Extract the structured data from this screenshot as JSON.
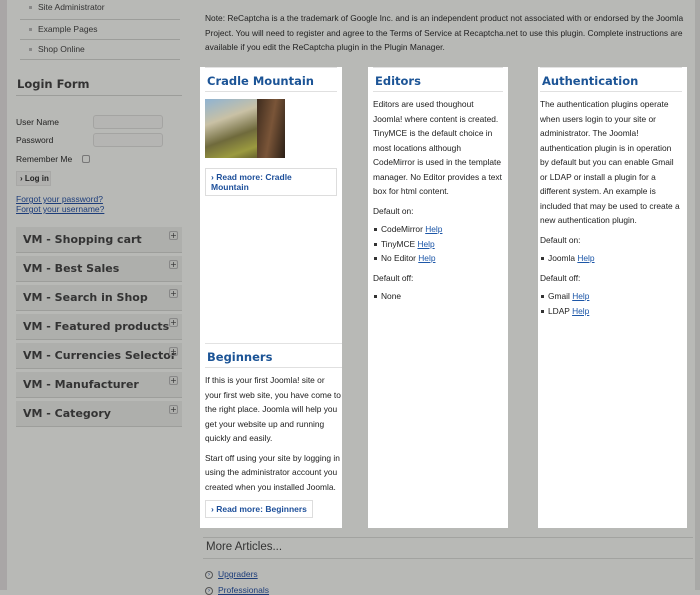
{
  "menu": [
    "Site Administrator",
    "Example Pages",
    "Shop Online"
  ],
  "login": {
    "title": "Login Form",
    "username_label": "User Name",
    "password_label": "Password",
    "remember_label": "Remember Me",
    "login_button": "Log in",
    "forgot_password": "Forgot your password?",
    "forgot_username": "Forgot your username?"
  },
  "modules": [
    "VM - Shopping cart",
    "VM - Best Sales",
    "VM - Search in Shop",
    "VM - Featured products",
    "VM - Currencies Selector",
    "VM - Manufacturer",
    "VM - Category"
  ],
  "note": "Note: ReCaptcha is a the trademark of Google Inc. and is an independent product not associated with or endorsed by the Joomla Project. You will need to register and agree to the Terms of Service at Recaptcha.net to use this plugin. Complete instructions are available if you edit the ReCaptcha plugin in the Plugin Manager.",
  "cradle": {
    "title": "Cradle Mountain",
    "read_more": "Read more: Cradle Mountain"
  },
  "beginners": {
    "title": "Beginners",
    "p1": "If this is your first Joomla! site or your first web site, you have come to the right place. Joomla will help you get your website up and running quickly and easily.",
    "p2": "Start off using your site by logging in using the administrator account you created when you installed Joomla.",
    "read_more": "Read more: Beginners"
  },
  "editors": {
    "title": "Editors",
    "p1": "Editors are used thoughout Joomla! where content is created. TinyMCE is the default choice in most locations although CodeMirror is used in the template manager. No Editor provides a text box for html content.",
    "on_label": "Default on:",
    "on": [
      "CodeMirror",
      "TinyMCE",
      "No Editor"
    ],
    "off_label": "Default off:",
    "off": [
      "None"
    ],
    "help": "Help"
  },
  "auth": {
    "title": "Authentication",
    "p1": "The authentication plugins operate when users login to your site or administrator. The Joomla! authentication plugin is in operation by default but you can enable Gmail or LDAP or install a plugin for a different system. An example is included that may be used to create a new authentication plugin.",
    "on_label": "Default on:",
    "on": [
      "Joomla"
    ],
    "off_label": "Default off:",
    "off": [
      "Gmail",
      "LDAP"
    ],
    "help": "Help"
  },
  "more": {
    "title": "More Articles...",
    "items": [
      "Upgraders",
      "Professionals"
    ]
  }
}
